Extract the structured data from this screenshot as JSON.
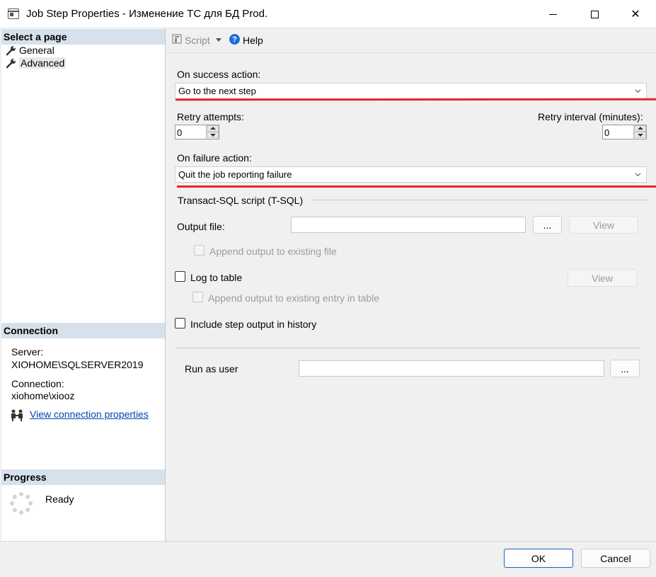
{
  "window": {
    "title": "Job Step Properties - Изменение ТС для БД Prod.",
    "close_glyph": "✕"
  },
  "left_pane": {
    "select_page_header": "Select a page",
    "pages": [
      {
        "label": "General",
        "icon": "wrench-icon",
        "selected": false
      },
      {
        "label": "Advanced",
        "icon": "wrench-icon",
        "selected": true
      }
    ],
    "connection_header": "Connection",
    "server_label": "Server:",
    "server_value": "XIOHOME\\SQLSERVER2019",
    "connection_label": "Connection:",
    "connection_value": "xiohome\\xiooz",
    "view_connection_link": "View connection properties",
    "progress_header": "Progress",
    "progress_status": "Ready"
  },
  "toolbar": {
    "script_label": "Script",
    "help_label": "Help"
  },
  "form": {
    "on_success_label": "On success action:",
    "on_success_value": "Go to the next step",
    "retry_attempts_label": "Retry attempts:",
    "retry_attempts_value": "0",
    "retry_interval_label": "Retry interval (minutes):",
    "retry_interval_value": "0",
    "on_failure_label": "On failure action:",
    "on_failure_value": "Quit the job reporting failure",
    "tsql_group_label": "Transact-SQL script (T-SQL)",
    "output_file_label": "Output file:",
    "output_file_value": "",
    "browse_label": "...",
    "view_label": "View",
    "append_output_label": "Append output to existing file",
    "log_to_table_label": "Log to table",
    "append_entry_label": "Append output to existing entry in table",
    "include_history_label": "Include step output in history",
    "run_as_user_label": "Run as user",
    "run_as_user_value": ""
  },
  "footer": {
    "ok_label": "OK",
    "cancel_label": "Cancel"
  },
  "colors": {
    "highlight_underline": "#e8242b",
    "section_header_bg": "#d6e1ec",
    "link": "#0645ad",
    "ok_border": "#1a63c0"
  }
}
